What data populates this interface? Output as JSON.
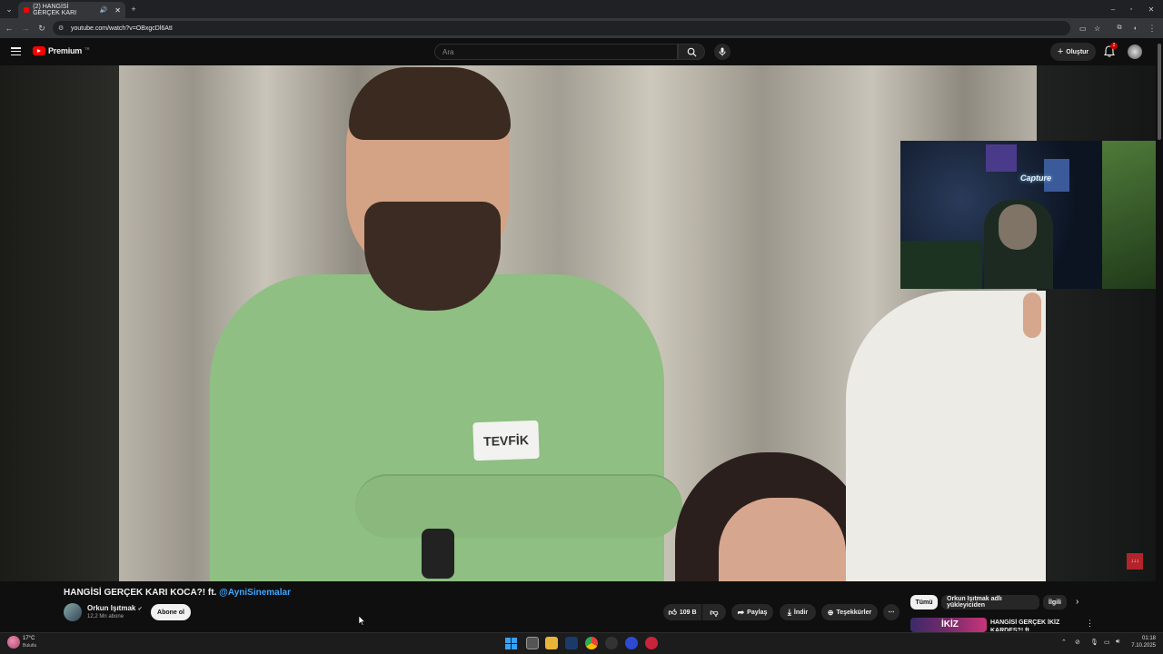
{
  "browser": {
    "tab_title": "(2) HANGİSİ GERÇEK KARI",
    "url": "youtube.com/watch?v=OBxgcDl6AtI"
  },
  "header": {
    "logo_label": "Premium",
    "logo_super": "TR",
    "search_placeholder": "Ara",
    "create_label": "Oluştur",
    "notification_count": "2"
  },
  "video": {
    "name_tag": "TEVFİK",
    "cam_sign": "Capture",
    "watermark": "↓↓↓"
  },
  "info": {
    "title_prefix": "HANGİSİ GERÇEK KARI KOCA?! ft.",
    "title_mention": "@AyniSinemalar",
    "channel_name": "Orkun Işıtmak",
    "subscribers": "12,2 Mn abone",
    "subscribe_label": "Abone ol",
    "like_count": "109 B",
    "share_label": "Paylaş",
    "download_label": "İndir",
    "thanks_label": "Teşekkürler"
  },
  "chips": [
    "Tümü",
    "Orkun Işıtmak adlı yükleyiciden",
    "İlgili"
  ],
  "recommendation": {
    "title": "HANGİSİ GERÇEK İKİZ KARDEŞ?! ft.",
    "thumb_text": "İKİZ"
  },
  "taskbar": {
    "weather_temp": "17°C",
    "weather_desc": "Bulutlu",
    "time": "01:18",
    "date": "7.10.2025"
  }
}
